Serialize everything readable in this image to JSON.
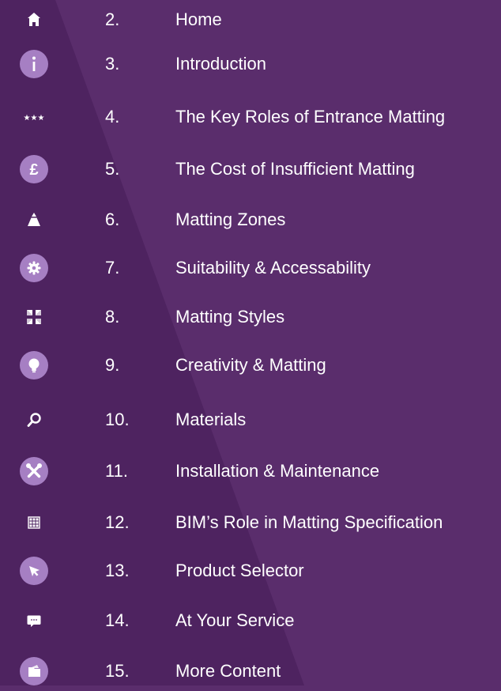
{
  "colors": {
    "background": "#5a2d6c",
    "background_diagonal": "#4e2360",
    "icon_circle": "#a67fc3",
    "text": "#ffffff"
  },
  "contents": [
    {
      "num": "2.",
      "label": "Home",
      "icon": "home-icon"
    },
    {
      "num": "3.",
      "label": "Introduction",
      "icon": "info-icon"
    },
    {
      "num": "4.",
      "label": "The Key Roles of Entrance Matting",
      "icon": "stars-icon"
    },
    {
      "num": "5.",
      "label": "The Cost of Insufficient Matting",
      "icon": "pound-icon"
    },
    {
      "num": "6.",
      "label": "Matting Zones",
      "icon": "zones-icon"
    },
    {
      "num": "7.",
      "label": "Suitability & Accessability",
      "icon": "gear-icon"
    },
    {
      "num": "8.",
      "label": "Matting Styles",
      "icon": "styles-icon"
    },
    {
      "num": "9.",
      "label": "Creativity & Matting",
      "icon": "lightbulb-icon"
    },
    {
      "num": "10.",
      "label": "Materials",
      "icon": "magnifier-icon"
    },
    {
      "num": "11.",
      "label": "Installation & Maintenance",
      "icon": "tools-icon"
    },
    {
      "num": "12.",
      "label": "BIM’s Role in Matting Specification",
      "icon": "bim-grid-icon"
    },
    {
      "num": "13.",
      "label": "Product Selector",
      "icon": "cursor-icon"
    },
    {
      "num": "14.",
      "label": "At Your Service",
      "icon": "chat-icon"
    },
    {
      "num": "15.",
      "label": "More Content",
      "icon": "folder-icon"
    }
  ]
}
